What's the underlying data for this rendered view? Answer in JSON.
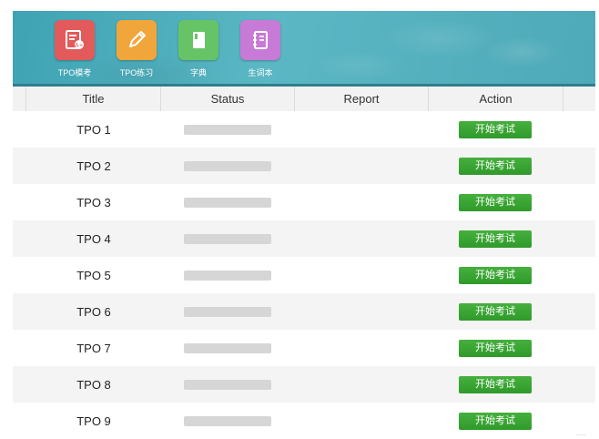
{
  "nav": [
    {
      "label": "TPO模考",
      "icon": "mock-exam-icon",
      "color": "#e35a5a"
    },
    {
      "label": "TPO练习",
      "icon": "pencil-icon",
      "color": "#f0a63a"
    },
    {
      "label": "字典",
      "icon": "dictionary-icon",
      "color": "#67c466"
    },
    {
      "label": "生词本",
      "icon": "notebook-icon",
      "color": "#c77ad6"
    }
  ],
  "table": {
    "headers": [
      "Title",
      "Status",
      "Report",
      "Action"
    ],
    "rows": [
      {
        "title": "TPO 1",
        "action": "开始考试"
      },
      {
        "title": "TPO 2",
        "action": "开始考试"
      },
      {
        "title": "TPO 3",
        "action": "开始考试"
      },
      {
        "title": "TPO 4",
        "action": "开始考试"
      },
      {
        "title": "TPO 5",
        "action": "开始考试"
      },
      {
        "title": "TPO 6",
        "action": "开始考试"
      },
      {
        "title": "TPO 7",
        "action": "开始考试"
      },
      {
        "title": "TPO 8",
        "action": "开始考试"
      },
      {
        "title": "TPO 9",
        "action": "开始考试"
      }
    ]
  },
  "watermark": "......"
}
